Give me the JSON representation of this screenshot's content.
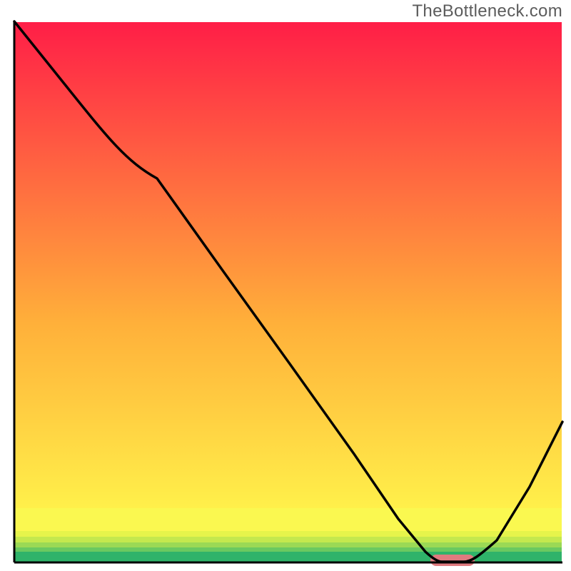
{
  "watermark": "TheBottleneck.com",
  "chart_data": {
    "type": "line",
    "title": "",
    "xlabel": "",
    "ylabel": "",
    "xlim": [
      0,
      100
    ],
    "ylim": [
      0,
      100
    ],
    "series": [
      {
        "name": "bottleneck-curve",
        "x": [
          0,
          8,
          18,
          26,
          38,
          50,
          62,
          70,
          75,
          78,
          82,
          88,
          94,
          100
        ],
        "values": [
          100,
          90,
          78,
          71,
          54,
          37,
          20,
          8,
          2,
          0,
          0,
          4,
          14,
          26
        ]
      }
    ],
    "marker": {
      "name": "optimal-range",
      "x_start": 76,
      "x_end": 84,
      "y": 0,
      "color": "#e07a7f"
    },
    "gradient_bands": [
      {
        "y0": 0,
        "y1": 2,
        "color": "#2fb36a"
      },
      {
        "y0": 2,
        "y1": 3,
        "color": "#6ac960"
      },
      {
        "y0": 3,
        "y1": 4,
        "color": "#9bd955"
      },
      {
        "y0": 4,
        "y1": 5,
        "color": "#c4e84e"
      },
      {
        "y0": 5,
        "y1": 6,
        "color": "#e6f44b"
      },
      {
        "y0": 6,
        "y1": 10,
        "color": "#faf850"
      },
      {
        "y0": 10,
        "y1": 100,
        "gradient_from": "#fff04a",
        "gradient_to": "#ff1e47"
      }
    ],
    "axes_color": "#000000"
  }
}
